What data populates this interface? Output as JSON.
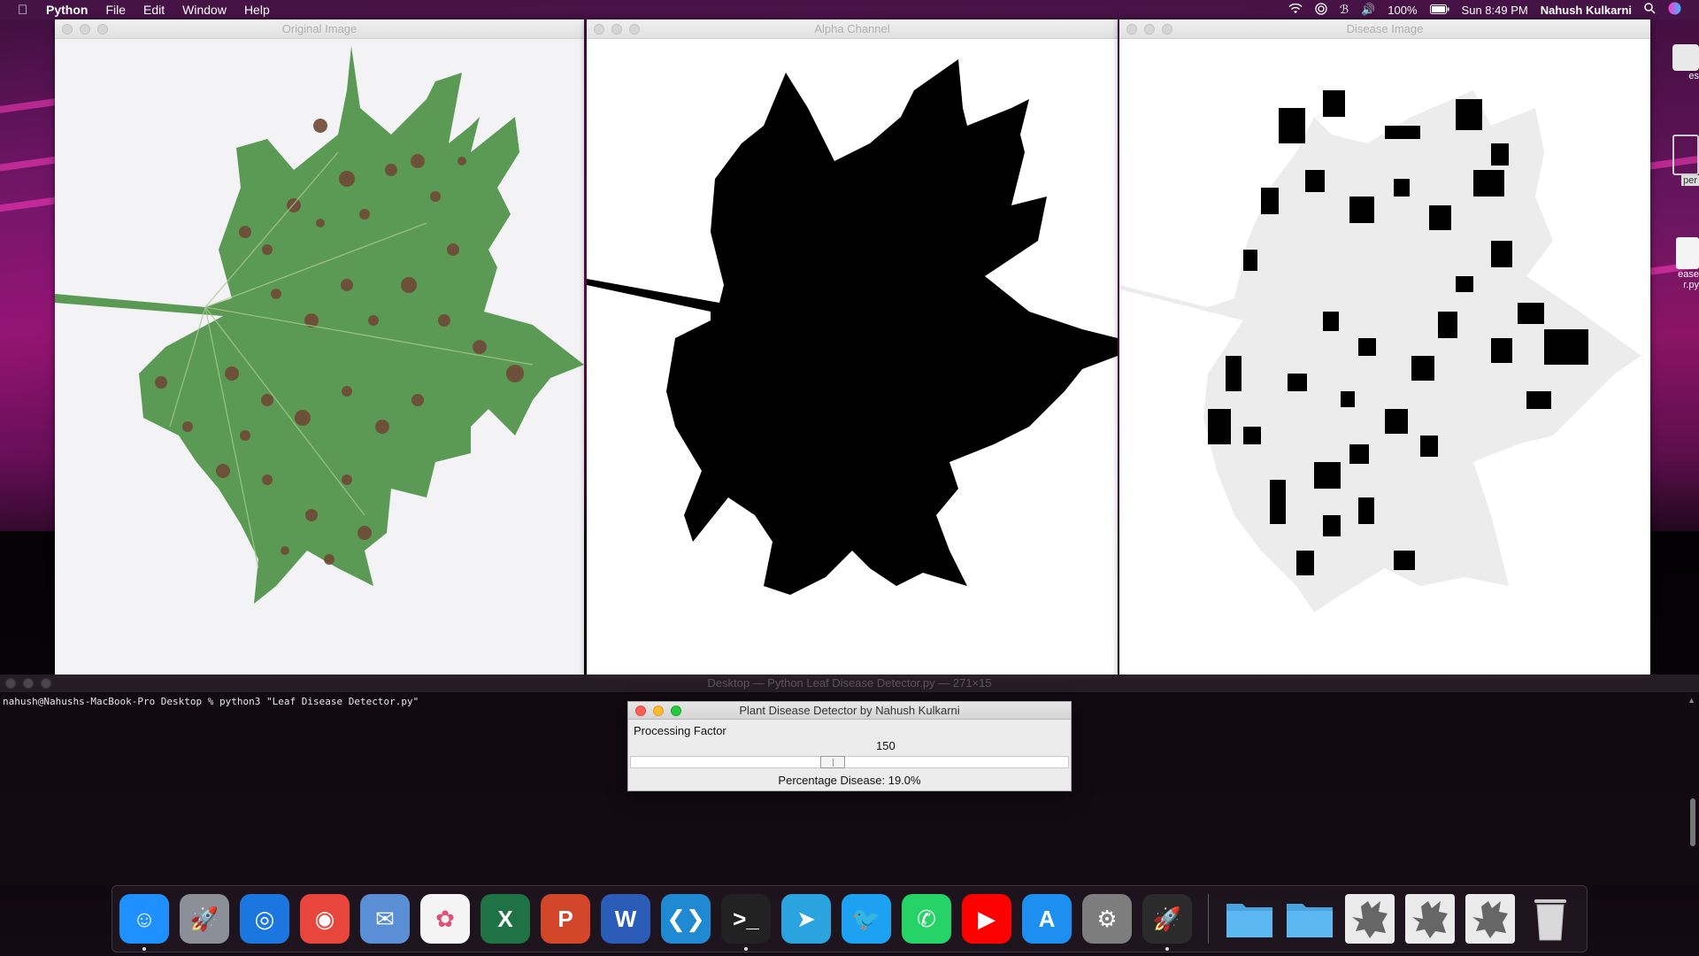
{
  "menubar": {
    "app_name": "Python",
    "menus": [
      "File",
      "Edit",
      "Window",
      "Help"
    ],
    "battery": "100%",
    "clock": "Sun 8:49 PM",
    "user": "Nahush Kulkarni"
  },
  "windows": {
    "original": {
      "title": "Original Image"
    },
    "alpha": {
      "title": "Alpha Channel"
    },
    "disease": {
      "title": "Disease Image"
    }
  },
  "terminal": {
    "title": "Desktop — Python Leaf Disease Detector.py — 271×15",
    "command_line": "nahush@Nahushs-MacBook-Pro Desktop % python3 \"Leaf Disease Detector.py\""
  },
  "dialog": {
    "title": "Plant Disease Detector by Nahush Kulkarni",
    "scale_label": "Processing Factor",
    "scale_value": "150",
    "scale_fraction": 0.46,
    "result": "Percentage Disease: 19.0%"
  },
  "desktop_items": [
    "es",
    "per",
    "ease",
    "r.py"
  ],
  "dock": {
    "apps": [
      {
        "name": "finder",
        "color": "#1e90ff",
        "glyph": "☺",
        "running": true
      },
      {
        "name": "launchpad",
        "color": "#8a8f98",
        "glyph": "🚀",
        "running": false
      },
      {
        "name": "safari",
        "color": "#1b76e0",
        "glyph": "◎",
        "running": false
      },
      {
        "name": "chrome",
        "color": "#e8453c",
        "glyph": "◉",
        "running": false
      },
      {
        "name": "preview",
        "color": "#5a8fd6",
        "glyph": "✉",
        "running": false
      },
      {
        "name": "photos",
        "color": "#f4f4f4",
        "glyph": "✿",
        "running": false
      },
      {
        "name": "excel",
        "color": "#1f7244",
        "glyph": "X",
        "running": false
      },
      {
        "name": "powerpoint",
        "color": "#d2472a",
        "glyph": "P",
        "running": false
      },
      {
        "name": "word",
        "color": "#2b5cb8",
        "glyph": "W",
        "running": false
      },
      {
        "name": "vscode",
        "color": "#1f8ad2",
        "glyph": "❮❯",
        "running": false
      },
      {
        "name": "terminal",
        "color": "#222222",
        "glyph": ">_",
        "running": true
      },
      {
        "name": "telegram",
        "color": "#2aa3de",
        "glyph": "➤",
        "running": false
      },
      {
        "name": "twitter",
        "color": "#1da1f2",
        "glyph": "🐦",
        "running": false
      },
      {
        "name": "whatsapp",
        "color": "#25d366",
        "glyph": "✆",
        "running": false
      },
      {
        "name": "youtube",
        "color": "#ff0000",
        "glyph": "▶",
        "running": false
      },
      {
        "name": "app-store",
        "color": "#1c8ff0",
        "glyph": "A",
        "running": false
      },
      {
        "name": "system-preferences",
        "color": "#7d7d7d",
        "glyph": "⚙",
        "running": false
      },
      {
        "name": "python-launcher",
        "color": "#2b2b2b",
        "glyph": "🚀",
        "running": true
      }
    ]
  }
}
